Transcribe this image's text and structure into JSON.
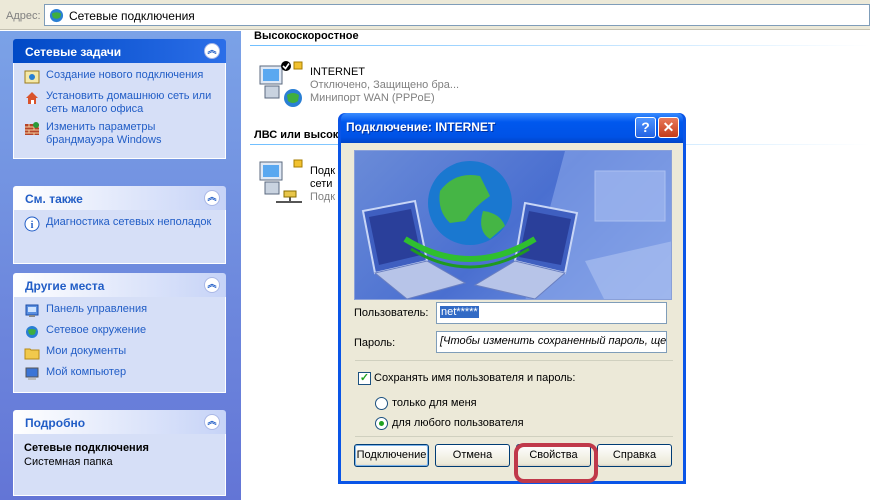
{
  "address": {
    "label": "Адрес:",
    "value": "Сетевые подключения",
    "icon": "network-connections-icon"
  },
  "sidebar": {
    "network_tasks": {
      "title": "Сетевые задачи",
      "items": [
        {
          "label": "Создание нового подключения",
          "icon": "new-connection-icon"
        },
        {
          "label": "Установить домашнюю сеть или сеть малого офиса",
          "icon": "home-network-icon"
        },
        {
          "label": "Изменить параметры брандмауэра Windows",
          "icon": "firewall-icon"
        }
      ]
    },
    "see_also": {
      "title": "См. также",
      "items": [
        {
          "label": "Диагностика сетевых неполадок",
          "icon": "info-icon"
        }
      ]
    },
    "other_places": {
      "title": "Другие места",
      "items": [
        {
          "label": "Панель управления",
          "icon": "control-panel-icon"
        },
        {
          "label": "Сетевое окружение",
          "icon": "network-places-icon"
        },
        {
          "label": "Мои документы",
          "icon": "my-documents-icon"
        },
        {
          "label": "Мой компьютер",
          "icon": "my-computer-icon"
        }
      ]
    },
    "details": {
      "title": "Подробно",
      "name": "Сетевые подключения",
      "type": "Системная папка"
    }
  },
  "main": {
    "section_broadband": "Высокоскоростное",
    "connection_internet": {
      "name": "INTERNET",
      "status": "Отключено, Защищено бра...",
      "device": "Минипорт WAN (PPPoE)"
    },
    "section_lan": "ЛВС или высок",
    "connection_lan": {
      "line1": "Подк",
      "line2": "сети",
      "line3": "Подк"
    }
  },
  "dialog": {
    "title": "Подключение: INTERNET",
    "help_label": "?",
    "close_label": "✕",
    "user_label": "Пользователь:",
    "user_value": "net*****",
    "password_label": "Пароль:",
    "password_value": "[Чтобы изменить сохраненный пароль, ще.",
    "save_label": "Сохранять имя пользователя и пароль:",
    "save_checked": true,
    "radio_me": "только для меня",
    "radio_any": "для любого пользователя",
    "selected_radio": "any",
    "buttons": {
      "connect": "Подключение",
      "cancel": "Отмена",
      "properties": "Свойства",
      "help": "Справка"
    }
  },
  "colors": {
    "title_blue": "#0058ee",
    "task_link": "#215dc6",
    "highlight_ring": "#c0394a"
  }
}
